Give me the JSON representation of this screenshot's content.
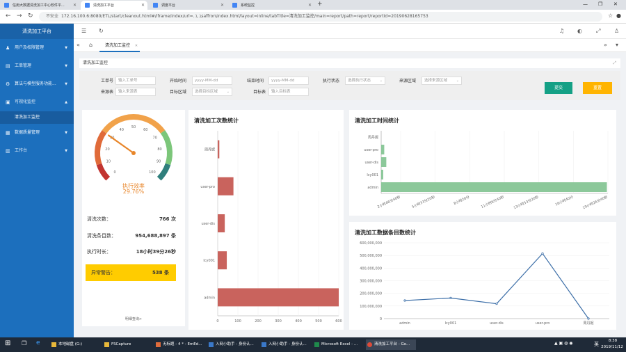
{
  "browser": {
    "tabs": [
      {
        "label": "信用大数据清洗加工中心软件平..."
      },
      {
        "label": "清洗加工平台"
      },
      {
        "label": "调度平台"
      },
      {
        "label": "系统监控"
      }
    ],
    "security_label": "不安全",
    "url": "172.16.100.6:8080/ETL/start/cleanout.html#/iframe/index/url=..\\..\\saffron\\index.html/layout=inline/tabTitle=清洗加工监控/main=report/path=report/reportId=20190628165753"
  },
  "sidebar": {
    "brand": "清洗加工平台",
    "items": [
      {
        "label": "用户及权限管理",
        "icon": "user-icon"
      },
      {
        "label": "工单管理",
        "icon": "document-icon"
      },
      {
        "label": "算法与模型服务功能...",
        "icon": "gear-icon"
      },
      {
        "label": "可视化监控",
        "icon": "monitor-icon"
      },
      {
        "label": "数据质量管理",
        "icon": "quality-icon"
      },
      {
        "label": "工作台",
        "icon": "workbench-icon"
      }
    ],
    "active_sub": "清洗加工监控"
  },
  "page_tab": {
    "label": "清洗加工监控"
  },
  "panel": {
    "title": "清洗加工监控"
  },
  "filters": {
    "order_label": "工单号",
    "order_placeholder": "输入工单号",
    "start_label": "开始时间",
    "start_placeholder": "yyyy-MM-dd",
    "end_label": "结束时间",
    "end_placeholder": "yyyy-MM-dd",
    "status_label": "执行状态",
    "status_placeholder": "选择执行状态",
    "region_label": "来源区域",
    "region_placeholder": "选择来源区域",
    "srctable_label": "来源表",
    "srctable_placeholder": "输入来源表",
    "target_region_label": "目标区域",
    "target_region_placeholder": "选择目标区域",
    "target_table_label": "目标表",
    "target_table_placeholder": "输入目标表",
    "submit_label": "提交",
    "reset_label": "重置"
  },
  "gauge": {
    "value": 29.76,
    "label": "执行效率",
    "value_text": "29.76%",
    "ticks": [
      "0",
      "10",
      "20",
      "30",
      "40",
      "50",
      "60",
      "70",
      "80",
      "90",
      "100"
    ]
  },
  "stats": {
    "count_label": "清洗次数：",
    "count_value": "766 次",
    "records_label": "清洗条目数：",
    "records_value": "954,688,897 条",
    "duration_label": "执行时长：",
    "duration_value": "18小时39分26秒",
    "alarm_label": "异常警告：",
    "alarm_value": "538 条",
    "detail_link": "明细查询>"
  },
  "colors": {
    "accent": "#1c6fbd",
    "submit": "#14a085",
    "reset": "#ffb400",
    "bar_red": "#c9635d",
    "bar_green": "#8cc89a",
    "line": "#3d6fa8",
    "alarm": "#ffcc00"
  },
  "chart_data": [
    {
      "type": "bar",
      "title": "清洗加工次数统计",
      "orientation": "horizontal",
      "categories": [
        "周丹妮",
        "user-pro",
        "user-dis",
        "lcy001",
        "admin"
      ],
      "values": [
        8,
        78,
        35,
        45,
        600
      ],
      "xlim": [
        0,
        600
      ],
      "xticks": [
        "0",
        "100",
        "200",
        "300",
        "400",
        "500",
        "600"
      ]
    },
    {
      "type": "bar",
      "title": "清洗加工时间统计",
      "orientation": "horizontal",
      "categories": [
        "周丹妮",
        "user-pro",
        "user-dis",
        "lcy001",
        "admin"
      ],
      "values": [
        0,
        3,
        5,
        2,
        220
      ],
      "xticks": [
        "2小时46分40秒",
        "5小时33分20秒",
        "8小时20分",
        "11小时6分40秒",
        "13小时53分20秒",
        "16小时40分",
        "19小时26分40秒"
      ]
    },
    {
      "type": "line",
      "title": "清洗加工数据条目数统计",
      "categories": [
        "admin",
        "lcy001",
        "user-dis",
        "user-pro",
        "周丹妮"
      ],
      "values": [
        143000000,
        163000000,
        118000000,
        515000000,
        0
      ],
      "ylim": [
        0,
        600000000
      ],
      "yticks": [
        "0",
        "100,000,000",
        "200,000,000",
        "300,000,000",
        "400,000,000",
        "500,000,000",
        "600,000,000"
      ]
    }
  ],
  "taskbar": {
    "items": [
      {
        "label": "本地磁盘 (G:)"
      },
      {
        "label": "FSCapture"
      },
      {
        "label": "无标题 - 4 * - EmEd..."
      },
      {
        "label": "入网小助手 - 身份认..."
      },
      {
        "label": "入网小助手 - 身份认..."
      },
      {
        "label": "Microsoft Excel - ..."
      },
      {
        "label": "清洗加工平台 - Go..."
      }
    ],
    "ime": "英",
    "time": "8:38",
    "date": "2019/11/12"
  }
}
